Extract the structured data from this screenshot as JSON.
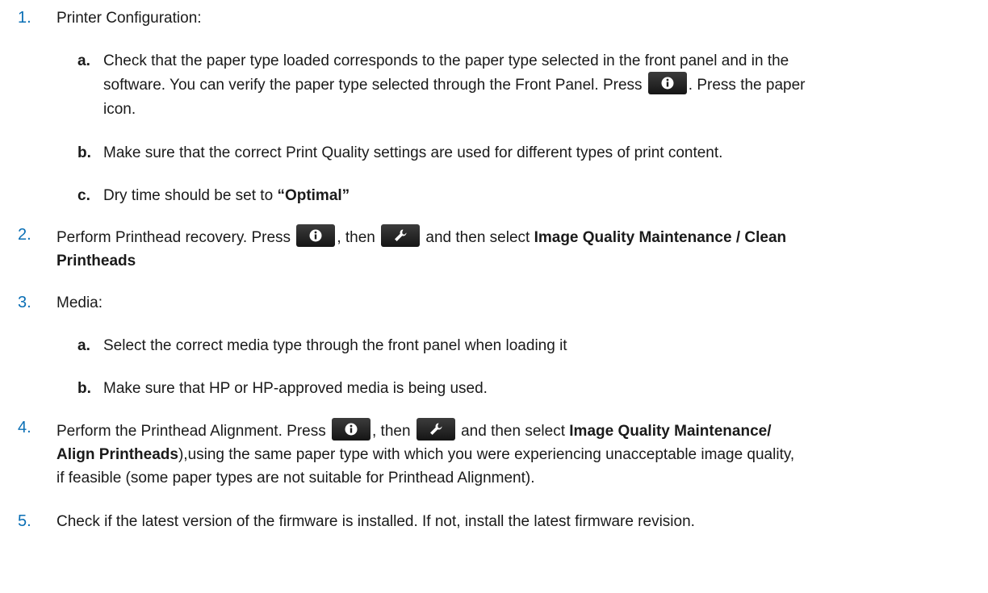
{
  "steps": [
    {
      "num": "1.",
      "text": "Printer Configuration:"
    },
    {
      "num": "2.",
      "text_a": "Perform Printhead recovery. Press",
      "text_b": ", then",
      "text_c": "and then select",
      "bold": "Image Quality Maintenance / Clean",
      "bold2": "Printheads"
    },
    {
      "num": "3.",
      "text": "Media:"
    },
    {
      "num": "4.",
      "text_a": "Perform the Printhead Alignment. Press",
      "text_b": ", then",
      "text_c": "and then select",
      "bold": "Image Quality Maintenance/",
      "bold2": "Align Printheads",
      "tail": "),using the same paper type with which you were experiencing unacceptable image quality,",
      "line3": "if feasible (some paper types are not suitable for Printhead Alignment)."
    },
    {
      "num": "5.",
      "text": "Check if the latest version of the firmware is installed. If not, install the latest firmware revision."
    }
  ],
  "substeps1": [
    {
      "letter": "a.",
      "line1": "Check that the paper type loaded corresponds to the paper type selected in the front panel and in the",
      "line2a": "software. You can verify the paper type selected through the Front Panel. Press",
      "line2b": ". Press the paper",
      "line3": "icon."
    },
    {
      "letter": "b.",
      "text": "Make sure that the correct Print Quality settings are used for different types of print content."
    },
    {
      "letter": "c.",
      "text": "Dry time should be set to",
      "bold": "“Optimal”"
    }
  ],
  "substeps3": [
    {
      "letter": "a.",
      "text": "Select the correct media type through the front panel when loading it"
    },
    {
      "letter": "b.",
      "text": "Make sure that HP or HP-approved media is being used."
    }
  ],
  "icons": {
    "info": "info-icon",
    "wrench": "wrench-icon"
  },
  "colors": {
    "number": "#0a6fb5",
    "text": "#1a1a1a",
    "button": "#1e1e1e"
  }
}
